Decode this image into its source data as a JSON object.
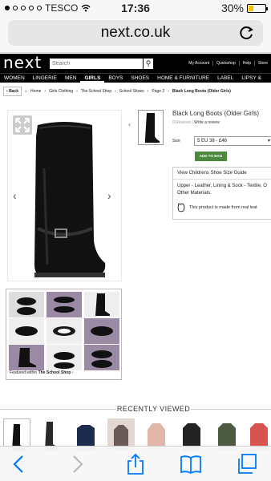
{
  "status_bar": {
    "carrier": "TESCO",
    "time": "17:36",
    "battery_percent": "30%",
    "battery_level": 0.3
  },
  "browser": {
    "url": "next.co.uk",
    "reload_icon": "reload-icon"
  },
  "site": {
    "logo": "next",
    "search_placeholder": "Search",
    "header_links": [
      "My Account",
      "Quickshop",
      "Help",
      "Store"
    ],
    "nav": [
      "WOMEN",
      "LINGERIE",
      "MEN",
      "GIRLS",
      "BOYS",
      "SHOES",
      "HOME & FURNITURE",
      "LABEL",
      "LIPSY &"
    ],
    "nav_active": "GIRLS"
  },
  "breadcrumb": {
    "back": "Back",
    "items": [
      "Home",
      "Girls Clothing",
      "The School Shop",
      "School Shoes",
      "Page 2"
    ],
    "current": "Black Long Boots (Older Girls)"
  },
  "product": {
    "title": "Black Long Boots (Older Girls)",
    "reviews": "0 Reviews",
    "write_review": "Write a review",
    "size_label": "Size",
    "size_value": "5 EU 38 - £46",
    "add_to_bag": "ADD TO BAG",
    "size_guide": "View Childrens Shoe Size Guide",
    "materials": "Upper - Leather, Lining & Sock - Textile, O",
    "materials2": "Other Materials.",
    "eco_text": "This product is made from real leat"
  },
  "featured": {
    "prefix": "Featured within",
    "shop": "The School Shop"
  },
  "recently_viewed": {
    "title": "RECENTLY VIEWED"
  },
  "colors": {
    "add_to_bag": "#4b8a3c",
    "ios_blue": "#007aff",
    "battery": "#f4c400"
  }
}
